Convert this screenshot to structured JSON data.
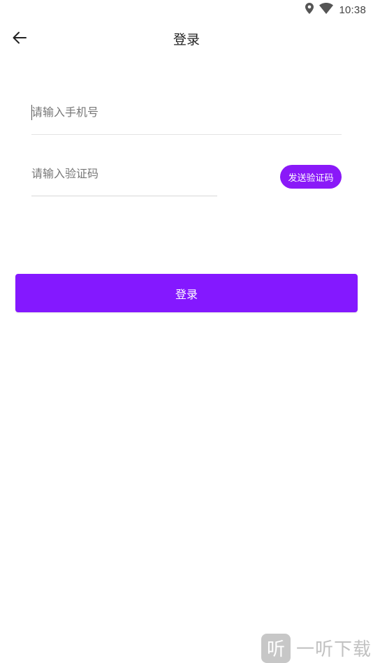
{
  "status_bar": {
    "time": "10:38",
    "icons": [
      "location-icon",
      "wifi-icon"
    ]
  },
  "header": {
    "title": "登录",
    "back_icon": "arrow-left-icon"
  },
  "form": {
    "phone_placeholder": "请输入手机号",
    "phone_value": "",
    "code_placeholder": "请输入验证码",
    "code_value": "",
    "send_code_label": "发送验证码",
    "submit_label": "登录"
  },
  "watermark": {
    "logo_char": "听",
    "text": "一听下载"
  },
  "colors": {
    "accent": "#8418ff",
    "send_button": "#8a19f8",
    "divider": "#e3e3e3"
  }
}
